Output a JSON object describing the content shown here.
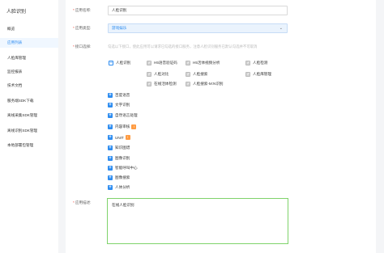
{
  "sidebar": {
    "title": "人脸识别",
    "items": [
      {
        "label": "概览",
        "active": false
      },
      {
        "label": "应用列表",
        "active": true
      },
      {
        "label": "人脸库管理",
        "active": false
      },
      {
        "label": "监控报表",
        "active": false
      },
      {
        "label": "技术文档",
        "active": false
      },
      {
        "label": "服务端SDK下载",
        "active": false
      },
      {
        "label": "离线采集SDK管理",
        "active": false
      },
      {
        "label": "离线识别SDK管理",
        "active": false
      },
      {
        "label": "本地部署包管理",
        "active": false
      }
    ]
  },
  "form": {
    "name_label": "应用名称:",
    "name_value": "人脸识别",
    "type_label": "应用类型:",
    "type_value": "游戏娱乐",
    "api_label": "接口选择:",
    "api_hint": "勾选以下接口，使此应用可以请求已勾选的接口服务，注意人脸识别服务已默认勾选并不可取消",
    "face_group": {
      "label": "人脸识别",
      "items": [
        {
          "label": "H5语音验证码",
          "checked": true
        },
        {
          "label": "H5活体视频分析",
          "checked": true
        },
        {
          "label": "人脸检测",
          "checked": true
        },
        {
          "label": "人脸对比",
          "checked": true
        },
        {
          "label": "人脸搜索",
          "checked": true
        },
        {
          "label": "人脸库管理",
          "checked": true
        },
        {
          "label": "在线活体检测",
          "checked": true
        },
        {
          "label": "人脸搜索-M:N识别",
          "checked": true
        }
      ]
    },
    "categories": [
      {
        "label": "百度语音",
        "badge": ""
      },
      {
        "label": "文字识别",
        "badge": ""
      },
      {
        "label": "自然语言处理",
        "badge": ""
      },
      {
        "label": "内容审核",
        "badge": "!"
      },
      {
        "label": "UNIT",
        "badge": "!"
      },
      {
        "label": "知识图谱",
        "badge": ""
      },
      {
        "label": "图像识别",
        "badge": ""
      },
      {
        "label": "智能呼叫中心",
        "badge": ""
      },
      {
        "label": "图像搜索",
        "badge": ""
      },
      {
        "label": "人体分析",
        "badge": ""
      }
    ],
    "desc_label": "应用描述:",
    "desc_value": "在线人脸识别"
  },
  "colors": {
    "accent": "#2d8cf0",
    "badge": "#ff9c43",
    "required": "#f04134",
    "focus_border": "#7fd36a"
  }
}
